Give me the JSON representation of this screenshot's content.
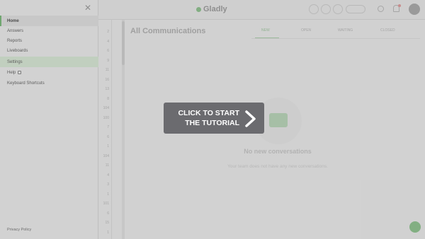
{
  "app": {
    "logo_text": "Gladly",
    "page_title": "All Communications",
    "tabs": [
      "NEW",
      "OPEN",
      "WAITING",
      "CLOSED"
    ],
    "empty_state": {
      "title": "No new conversations",
      "subtitle": "Your team does not have any new conversations."
    },
    "row_numbers": [
      "2",
      "4",
      "6",
      "9",
      "11",
      "16",
      "13",
      "8",
      "104",
      "100",
      "7",
      "6",
      "1",
      "104",
      "11",
      "4",
      "3",
      "1",
      "101",
      "6",
      "15",
      "1"
    ]
  },
  "menu": {
    "items": [
      {
        "label": "Home",
        "state": "selected"
      },
      {
        "label": "Answers",
        "state": ""
      },
      {
        "label": "Reports",
        "state": ""
      },
      {
        "label": "Liveboards",
        "state": ""
      },
      {
        "label": "Settings",
        "state": "highlight"
      },
      {
        "label": "Help",
        "state": "",
        "external": true
      },
      {
        "label": "Keyboard Shortcuts",
        "state": ""
      }
    ],
    "footer": "Privacy Policy"
  },
  "tutorial": {
    "line1": "CLICK TO START",
    "line2": "THE TUTORIAL"
  },
  "colors": {
    "accent": "#6aa86a",
    "cta_bg": "#6b6b6f"
  }
}
